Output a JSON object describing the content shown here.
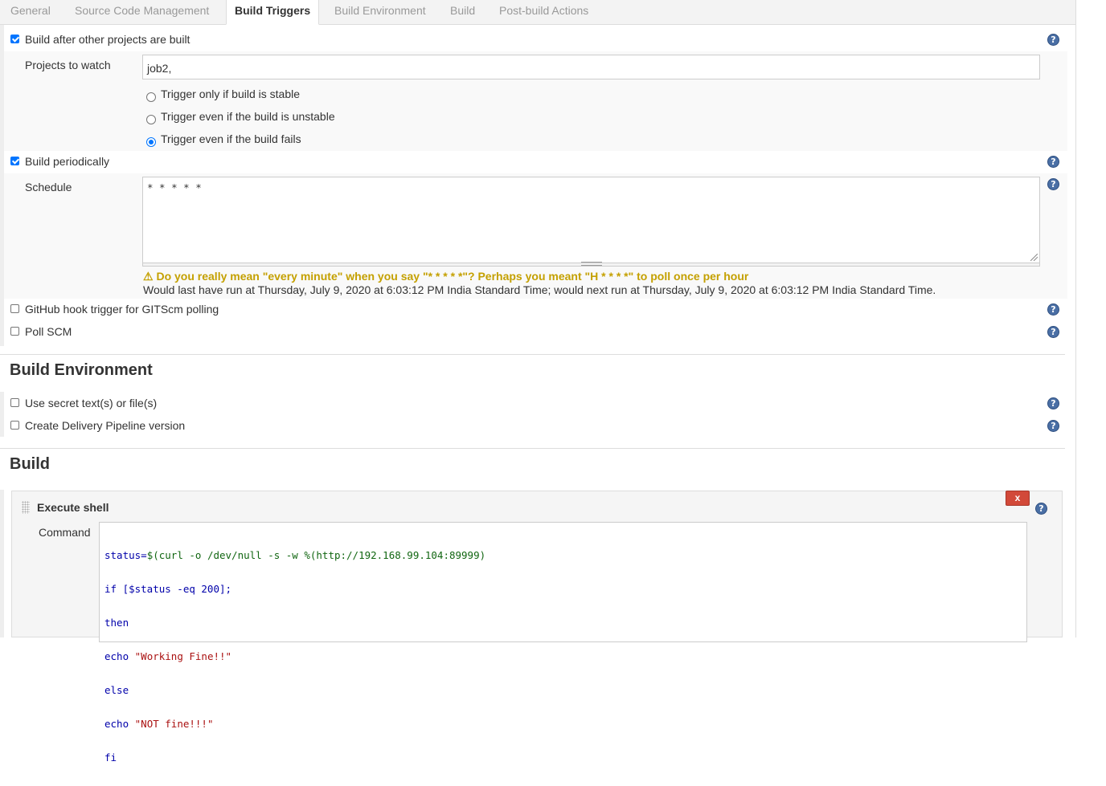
{
  "tabs": [
    "General",
    "Source Code Management",
    "Build Triggers",
    "Build Environment",
    "Build",
    "Post-build Actions"
  ],
  "triggers": {
    "build_after_label": "Build after other projects are built",
    "projects_label": "Projects to watch",
    "projects_value": "job2,",
    "radio_stable": "Trigger only if build is stable",
    "radio_unstable": "Trigger even if the build is unstable",
    "radio_fails": "Trigger even if the build fails",
    "selected_radio": "fails",
    "periodic_label": "Build periodically",
    "schedule_label": "Schedule",
    "schedule_value": "* * * * *",
    "warning": "Do you really mean \"every minute\" when you say \"* * * * *\"? Perhaps you meant \"H * * * *\" to poll once per hour",
    "run_info": "Would last have run at Thursday, July 9, 2020 at 6:03:12 PM India Standard Time; would next run at Thursday, July 9, 2020 at 6:03:12 PM India Standard Time.",
    "github_label": "GitHub hook trigger for GITScm polling",
    "pollscm_label": "Poll SCM"
  },
  "build_env": {
    "title": "Build Environment",
    "secret_label": "Use secret text(s) or file(s)",
    "pipeline_label": "Create Delivery Pipeline version"
  },
  "build": {
    "title": "Build",
    "step_title": "Execute shell",
    "delete_label": "x",
    "command_label": "Command",
    "command_lines": [
      "status=$(curl -o /dev/null -s -w %(http://192.168.99.104:89999)",
      "if [$status -eq 200];",
      "then",
      "echo \"Working Fine!!\"",
      "else",
      "echo \"NOT fine!!!\"",
      "fi"
    ]
  },
  "icons": {
    "help": "help-icon",
    "warning": "warning-icon",
    "drag": "drag-handle-icon",
    "resize": "resize-grip-icon"
  },
  "help_glyph": "?",
  "warning_glyph": "⚠",
  "colors": {
    "accent_blue": "#0075ff",
    "warning_text": "#c4a000",
    "delete_button": "#d24939",
    "help_icon": "#4a6fa5"
  }
}
